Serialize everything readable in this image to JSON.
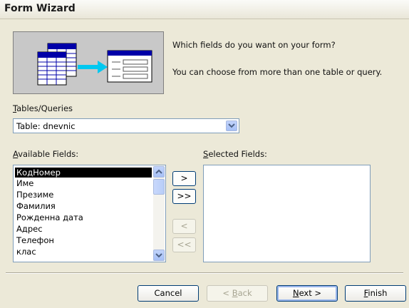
{
  "window": {
    "title": "Form Wizard"
  },
  "intro": {
    "question": "Which fields do you want on your form?",
    "hint": "You can choose from more than one table or query."
  },
  "tables_queries": {
    "label": "Tables/Queries",
    "accel": "T",
    "label_rest": "ables/Queries",
    "selected": "Table: dnevnic"
  },
  "available": {
    "accel": "A",
    "label_rest": "vailable Fields:",
    "items": [
      "КодНомер",
      "Име",
      "Презиме",
      "Фамилия",
      "Рожденна дата",
      "Адрес",
      "Телефон",
      "клас"
    ],
    "selected_index": 0
  },
  "selected_fields": {
    "accel": "S",
    "label_rest": "elected Fields:"
  },
  "move_buttons": {
    "add_one": ">",
    "add_all": ">>",
    "remove_one": "<",
    "remove_all": "<<"
  },
  "buttons": {
    "cancel": "Cancel",
    "back_accel": "B",
    "back_pre": "< ",
    "back_rest": "ack",
    "next_accel": "N",
    "next_rest": "ext >",
    "finish_accel": "F",
    "finish_rest": "inish"
  },
  "colors": {
    "accent_border": "#003c74",
    "highlight": "#000000",
    "face": "#ece9d8"
  }
}
